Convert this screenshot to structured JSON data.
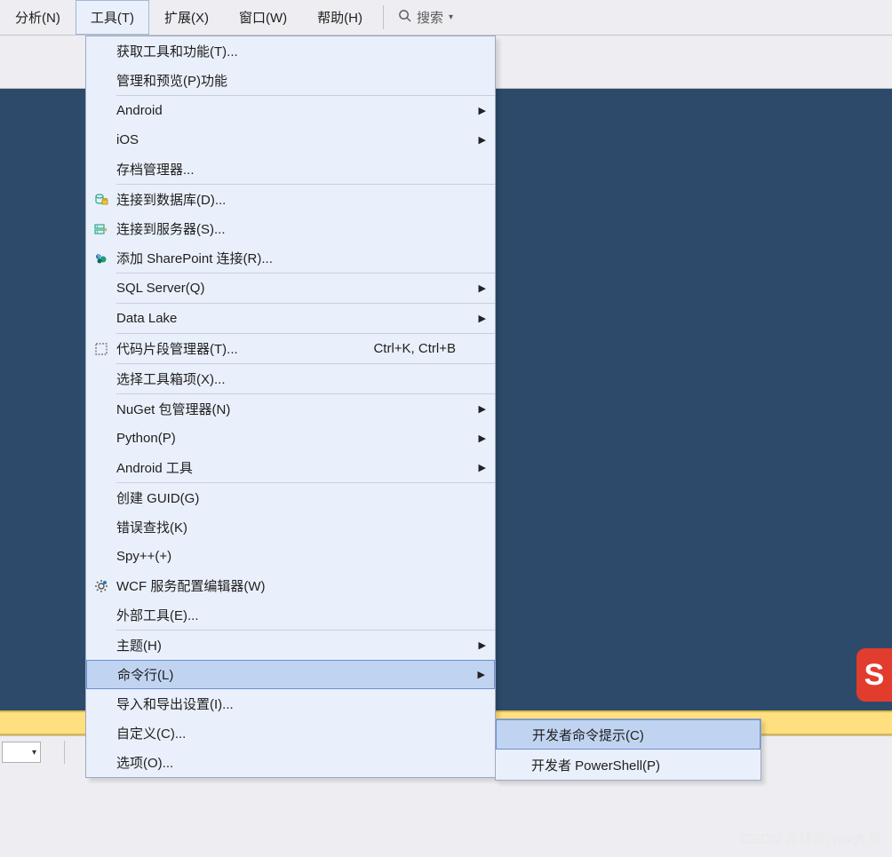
{
  "menubar": {
    "items": [
      {
        "label": "分析(N)"
      },
      {
        "label": "工具(T)",
        "active": true
      },
      {
        "label": "扩展(X)"
      },
      {
        "label": "窗口(W)"
      },
      {
        "label": "帮助(H)"
      }
    ],
    "search_label": "搜索"
  },
  "tools_menu": [
    {
      "type": "item",
      "label": "获取工具和功能(T)..."
    },
    {
      "type": "item",
      "label": "管理和预览(P)功能"
    },
    {
      "type": "sep"
    },
    {
      "type": "item",
      "label": "Android",
      "submenu": true
    },
    {
      "type": "item",
      "label": "iOS",
      "submenu": true
    },
    {
      "type": "item",
      "label": "存档管理器..."
    },
    {
      "type": "sep"
    },
    {
      "type": "item",
      "label": "连接到数据库(D)...",
      "icon": "database-icon"
    },
    {
      "type": "item",
      "label": "连接到服务器(S)...",
      "icon": "server-icon"
    },
    {
      "type": "item",
      "label": "添加 SharePoint 连接(R)...",
      "icon": "sharepoint-icon"
    },
    {
      "type": "sep"
    },
    {
      "type": "item",
      "label": "SQL Server(Q)",
      "submenu": true
    },
    {
      "type": "sep"
    },
    {
      "type": "item",
      "label": "Data Lake",
      "submenu": true
    },
    {
      "type": "sep"
    },
    {
      "type": "item",
      "label": "代码片段管理器(T)...",
      "icon": "snippet-icon",
      "shortcut": "Ctrl+K, Ctrl+B"
    },
    {
      "type": "sep"
    },
    {
      "type": "item",
      "label": "选择工具箱项(X)..."
    },
    {
      "type": "sep"
    },
    {
      "type": "item",
      "label": "NuGet 包管理器(N)",
      "submenu": true
    },
    {
      "type": "item",
      "label": "Python(P)",
      "submenu": true
    },
    {
      "type": "item",
      "label": "Android 工具",
      "submenu": true
    },
    {
      "type": "sep"
    },
    {
      "type": "item",
      "label": "创建 GUID(G)"
    },
    {
      "type": "item",
      "label": "错误查找(K)"
    },
    {
      "type": "item",
      "label": "Spy++(+)"
    },
    {
      "type": "item",
      "label": "WCF 服务配置编辑器(W)",
      "icon": "gear-icon"
    },
    {
      "type": "item",
      "label": "外部工具(E)..."
    },
    {
      "type": "sep"
    },
    {
      "type": "item",
      "label": "主题(H)",
      "submenu": true
    },
    {
      "type": "sep"
    },
    {
      "type": "item",
      "label": "命令行(L)",
      "submenu": true,
      "highlight": true
    },
    {
      "type": "sep"
    },
    {
      "type": "item",
      "label": "导入和导出设置(I)..."
    },
    {
      "type": "item",
      "label": "自定义(C)..."
    },
    {
      "type": "item",
      "label": "选项(O)..."
    }
  ],
  "commandline_submenu": [
    {
      "label": "开发者命令提示(C)",
      "highlight": true
    },
    {
      "label": "开发者 PowerShell(P)"
    }
  ],
  "watermark": "CSDN @环能jvav大师",
  "badge": "S"
}
